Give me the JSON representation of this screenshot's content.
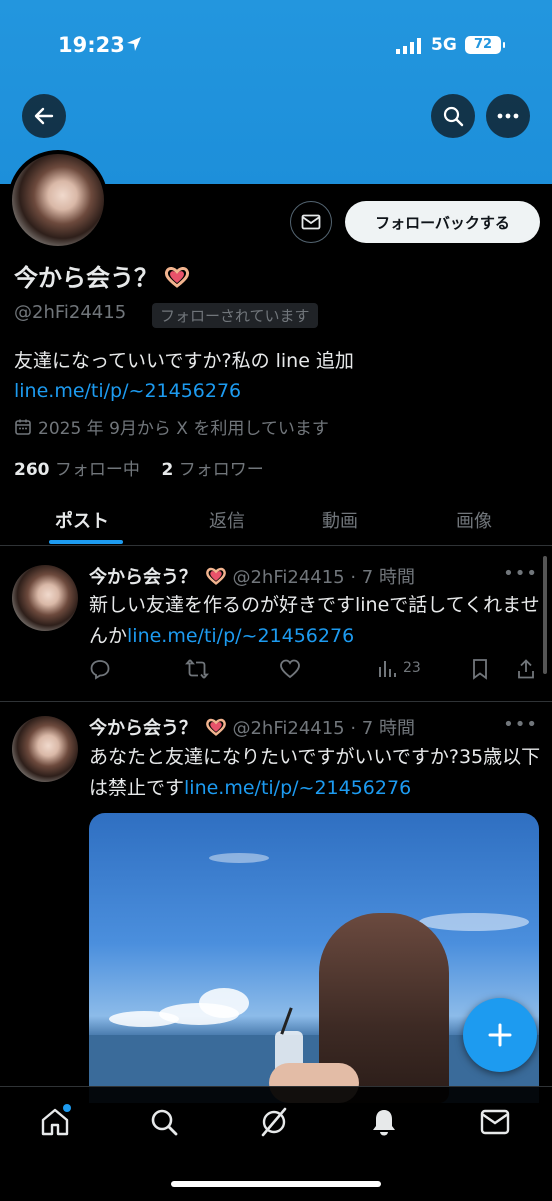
{
  "status_bar": {
    "time": "19:23",
    "network": "5G",
    "battery": "72"
  },
  "profile": {
    "name": "今から会う？",
    "handle": "@2hFi24415",
    "follows_you_badge": "フォローされています",
    "follow_back_label": "フォローバックする",
    "bio_text": "友達になっていいですか?私の line 追加 ",
    "bio_link": "line.me/ti/p/~21456276",
    "joined": "2025 年 9月から X を利用しています",
    "following_count": "260",
    "following_label": "フォロー中",
    "followers_count": "2",
    "followers_label": "フォロワー"
  },
  "tabs": [
    "ポスト",
    "返信",
    "動画",
    "画像"
  ],
  "posts": [
    {
      "name": "今から会う？",
      "meta": "@2hFi24415 · 7 時間",
      "text": "新しい友達を作るのが好きですlineで話してくれませんか",
      "link": "line.me/ti/p/~21456276",
      "views": "23"
    },
    {
      "name": "今から会う？",
      "meta": "@2hFi24415 · 7 時間",
      "text": "あなたと友達になりたいですがいいですか?35歳以下は禁止です",
      "link": "line.me/ti/p/~21456276"
    }
  ],
  "colors": {
    "accent": "#1d9bf0",
    "banner": "#2396de",
    "background": "#000000"
  },
  "icons": {
    "back": "back-arrow-icon",
    "search": "search-icon",
    "more": "more-icon",
    "message": "envelope-icon",
    "calendar": "calendar-icon",
    "reply": "reply-icon",
    "repost": "repost-icon",
    "like": "heart-icon",
    "views": "views-icon",
    "bookmark": "bookmark-icon",
    "share": "share-icon",
    "compose": "plus-icon",
    "nav": [
      "home-icon",
      "search-icon",
      "grok-icon",
      "bell-icon",
      "envelope-icon"
    ]
  }
}
